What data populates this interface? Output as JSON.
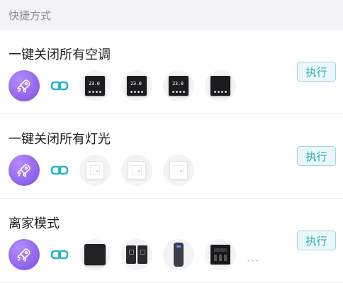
{
  "header": {
    "title": "快捷方式"
  },
  "colors": {
    "accent": "#2aa8b4",
    "rocket": "#8b5cf6",
    "link": "#25b4c8"
  },
  "scenes": [
    {
      "title": "一键关闭所有空调",
      "execute_label": "执行",
      "devices": [
        {
          "kind": "thermostat",
          "display": "23.0"
        },
        {
          "kind": "thermostat",
          "display": "23.0"
        },
        {
          "kind": "thermostat",
          "display": "23.0"
        },
        {
          "kind": "thermostat-panel",
          "display": ""
        }
      ]
    },
    {
      "title": "一键关闭所有灯光",
      "execute_label": "执行",
      "devices": [
        {
          "kind": "wall-switch"
        },
        {
          "kind": "wall-switch"
        },
        {
          "kind": "wall-switch"
        }
      ]
    },
    {
      "title": "离家模式",
      "execute_label": "执行",
      "devices": [
        {
          "kind": "speaker"
        },
        {
          "kind": "dual-switch"
        },
        {
          "kind": "smart-plug"
        },
        {
          "kind": "control-board"
        }
      ],
      "more": "···"
    }
  ]
}
